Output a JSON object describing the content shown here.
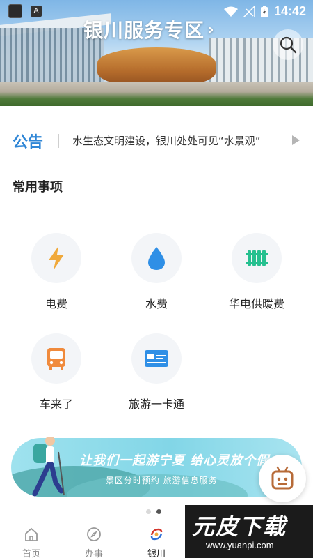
{
  "status_bar": {
    "time": "14:42",
    "app_badge": "A"
  },
  "header": {
    "title": "银川服务专区",
    "title_chevron": "›",
    "accent": "#ffffff"
  },
  "notice": {
    "tag": "公告",
    "text": "水生态文明建设，银川处处可见“水景观”",
    "tag_color": "#2f86d6"
  },
  "section": {
    "title": "常用事项"
  },
  "services": [
    {
      "label": "电费",
      "icon": "lightning-icon",
      "color": "#f0a93b"
    },
    {
      "label": "水费",
      "icon": "water-drop-icon",
      "color": "#2f8fe6"
    },
    {
      "label": "华电供暖费",
      "icon": "radiator-icon",
      "color": "#25c08f"
    },
    {
      "label": "车来了",
      "icon": "bus-icon",
      "color": "#f08a3c"
    },
    {
      "label": "旅游一卡通",
      "icon": "card-icon",
      "color": "#2f8fe6"
    }
  ],
  "banner": {
    "slogan": "让我们一起游宁夏 给心灵放个假",
    "subtitle": "— 景区分时预约 旅游信息服务 —"
  },
  "carousel": {
    "pages": 2,
    "active": 2
  },
  "tabbar": {
    "tabs": [
      {
        "label": "首页",
        "icon": "home-icon",
        "active": false
      },
      {
        "label": "办事",
        "icon": "compass-icon",
        "active": false
      },
      {
        "label": "银川",
        "icon": "yinchuan-logo-icon",
        "active": true
      }
    ]
  },
  "watermark": {
    "main": "元皮下载",
    "url": "www.yuanpi.com"
  }
}
